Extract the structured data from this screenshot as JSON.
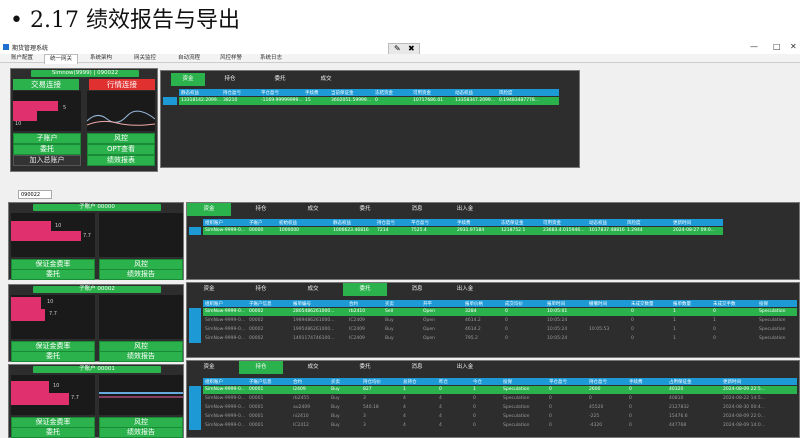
{
  "heading": "• 2.17 绩效报告与导出",
  "window": {
    "title": "期货管理系统",
    "tabs": [
      "账户配置",
      "统一网关",
      "系统架构",
      "网关监控",
      "自动流程",
      "风控样警",
      "系统日志"
    ],
    "active_tab": 1,
    "controls": {
      "minimize": "—",
      "restore": "□",
      "close": "✕"
    }
  },
  "main_account": {
    "label": "Simnow(9999) | 090022",
    "connect_trade": "交易连接",
    "connect_market": "行情连接",
    "axis_a": "10",
    "axis_b": "5",
    "buttons": {
      "sub_account": "子账户",
      "risk": "风控",
      "entrust": "委托",
      "opt_view": "OPT查看",
      "add_main": "加入总账户",
      "perf_report": "绩效报表"
    }
  },
  "top_tabs": [
    "资金",
    "持仓",
    "委托",
    "成交"
  ],
  "top_table": {
    "headers": [
      "静态权益",
      "持仓盈亏",
      "平仓盈亏",
      "手续费",
      "当前保证金",
      "冻结资金",
      "可用资金",
      "动态权益",
      "风险度"
    ],
    "row": [
      "13318142.2099...",
      "38210",
      "-1169.99999999...",
      "15",
      "3602051.59999...",
      "0",
      "10717686.01",
      "13358347.2099...",
      "0.19483487778..."
    ]
  },
  "account_input": "090022",
  "sub_accounts": [
    {
      "label": "子账户 00000",
      "axis": [
        "10",
        "7.7"
      ],
      "buttons": {
        "margin": "保证金费率",
        "risk": "风控",
        "entrust": "委托",
        "perf": "绩效报告"
      }
    },
    {
      "label": "子账户 00002",
      "axis": [
        "10",
        "7.7"
      ],
      "buttons": {
        "margin": "保证金费率",
        "risk": "风控",
        "entrust": "委托",
        "perf": "绩效报告"
      }
    },
    {
      "label": "子账户 00001",
      "axis": [
        "10",
        "7.7"
      ],
      "buttons": {
        "margin": "保证金费率",
        "risk": "风控",
        "entrust": "委托",
        "perf": "绩效报告"
      }
    }
  ],
  "detail_tabs": [
    "资金",
    "持仓",
    "成交",
    "委托",
    "消息",
    "出入金"
  ],
  "funds_table": {
    "headers": [
      "组织账户",
      "子账户",
      "初始权益",
      "静态权益",
      "持仓盈亏",
      "平仓盈亏",
      "手续费",
      "冻结保证金",
      "可用资金",
      "动态权益",
      "风险度",
      "更新时间"
    ],
    "row": [
      "SimNow-9999-0...",
      "00000",
      "1000000",
      "1006623.46816",
      "7214",
      "7525.4",
      "2931.97184",
      "1218752.1",
      "23683.4.015946...",
      "1017837.48816",
      "1.2944",
      "2024-08-27 09:0..."
    ]
  },
  "orders_tabs": [
    "资金",
    "持仓",
    "成交",
    "委托",
    "消息",
    "出入金"
  ],
  "orders_table": {
    "headers": [
      "组织账户",
      "子账户信息",
      "报单编号",
      "合约",
      "买卖",
      "开平",
      "报单价格",
      "成交均价",
      "报单时间",
      "撤撤时间",
      "未成交数量",
      "报单数量",
      "未成交手数",
      "投保"
    ],
    "rows": [
      [
        "SimNow-9999-0...",
        "00002",
        "2805486261000...",
        "rb2410",
        "Sell",
        "Open",
        "3284",
        "0",
        "10:05:01",
        "",
        "0",
        "1",
        "0",
        "Speculation"
      ],
      [
        "SimNow-9999-0...",
        "00002",
        "1989486261000...",
        "IC2409",
        "Buy",
        "Open",
        "4614.2",
        "0",
        "10:05:24",
        "",
        "0",
        "1",
        "1",
        "Speculation"
      ],
      [
        "SimNow-9999-0...",
        "00002",
        "1995486261000...",
        "IC2409",
        "Buy",
        "Open",
        "4614.2",
        "0",
        "10:05:24",
        "10:05:53",
        "0",
        "1",
        "0",
        "Speculation"
      ],
      [
        "SimNow-9999-0...",
        "00002",
        "1491174746100...",
        "IC2409",
        "Buy",
        "Open",
        "795.2",
        "0",
        "10:05:24",
        "",
        "0",
        "1",
        "0",
        "Speculation"
      ]
    ]
  },
  "pos_tabs": [
    "资金",
    "持仓",
    "成交",
    "委托",
    "消息",
    "出入金"
  ],
  "pos_table": {
    "headers": [
      "组织账户",
      "子账户信息",
      "合约",
      "买卖",
      "持仓均价",
      "总持仓",
      "昨仓",
      "今仓",
      "投保",
      "平仓盈亏",
      "持仓盈亏",
      "手续费",
      "占用保证金",
      "更新时间"
    ],
    "rows": [
      [
        "SimNow-9999-0...",
        "00001",
        "i2409",
        "Buy",
        "827",
        "1",
        "0",
        "1",
        "Speculation",
        "0",
        "2600",
        "0",
        "40320",
        "2024-08-09 22:5..."
      ],
      [
        "SimNow-9999-0...",
        "00001",
        "rb2455",
        "Buy",
        "3",
        "4",
        "4",
        "0",
        "Speculation",
        "0",
        "0",
        "0",
        "40810",
        "2024-08-22 14:5..."
      ],
      [
        "SimNow-9999-0...",
        "00001",
        "au2409",
        "Buy",
        "540.18",
        "4",
        "4",
        "0",
        "Speculation",
        "0",
        "45520",
        "0",
        "2127832",
        "2024-08-30 00:4..."
      ],
      [
        "SimNow-9999-0...",
        "00001",
        "ni2410",
        "Buy",
        "3",
        "4",
        "4",
        "0",
        "Speculation",
        "0",
        "-225",
        "0",
        "15476.6",
        "2024-08-09 22:0..."
      ],
      [
        "SimNow-9999-0...",
        "00001",
        "IC2412",
        "Buy",
        "3",
        "4",
        "4",
        "0",
        "Speculation",
        "0",
        "-4320",
        "0",
        "447768",
        "2024-08-09 14:0..."
      ]
    ]
  }
}
